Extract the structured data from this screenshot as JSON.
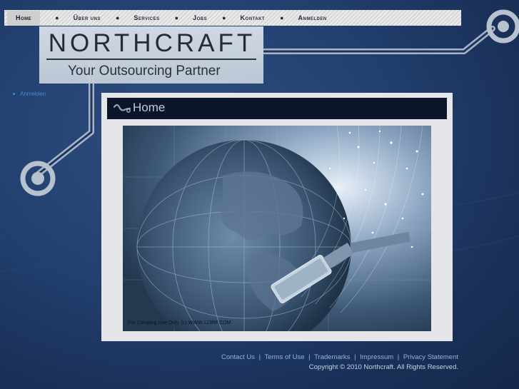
{
  "nav": {
    "items": [
      {
        "label": "Home"
      },
      {
        "label": "Über uns"
      },
      {
        "label": "Services"
      },
      {
        "label": "Jobs"
      },
      {
        "label": "Kontakt"
      },
      {
        "label": "Anmelden"
      }
    ],
    "separator": "●"
  },
  "logo": {
    "name": "NORTHCRAFT",
    "tagline": "Your Outsourcing Partner"
  },
  "sidebar": {
    "link": "Anmelden"
  },
  "content": {
    "title": "Home",
    "image_watermark": "For Comping Use Only. (c) WWW.123RF.COM"
  },
  "footer": {
    "links": [
      {
        "label": "Contact Us"
      },
      {
        "label": "Terms of Use"
      },
      {
        "label": "Trademarks"
      },
      {
        "label": "Impressum"
      },
      {
        "label": "Privacy Statement"
      }
    ],
    "separator": "|",
    "copyright": "Copyright © 2010 Northcraft. All Rights Reserved."
  },
  "colors": {
    "background": "#223f6e",
    "title_bar": "#0b1428",
    "footer_link": "#8fb4e3"
  }
}
